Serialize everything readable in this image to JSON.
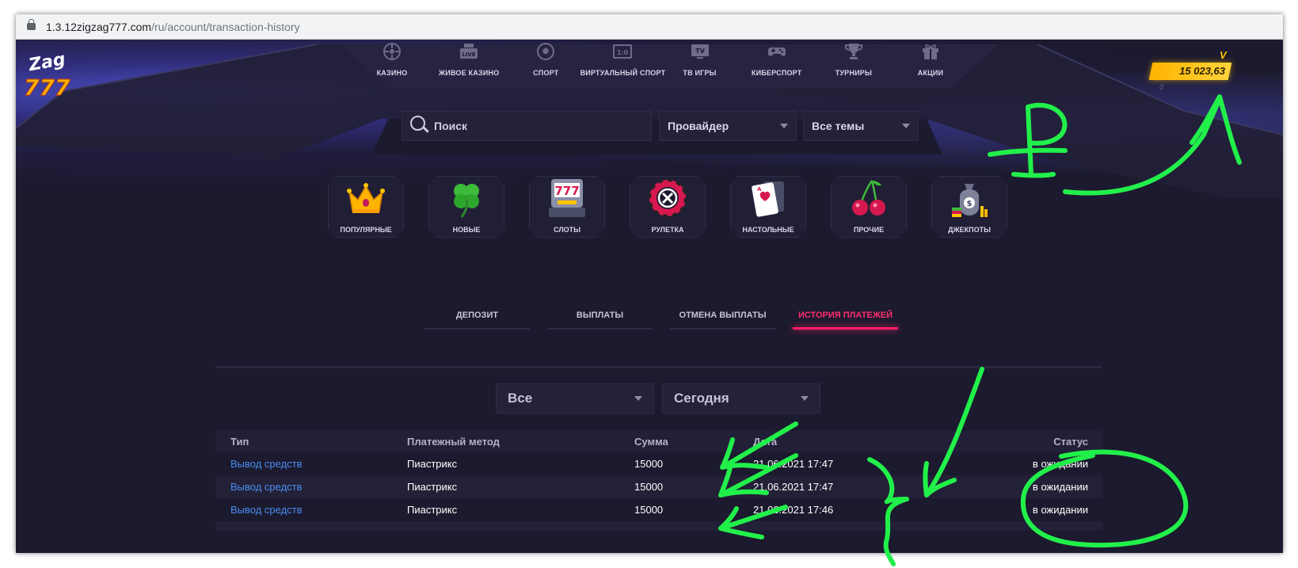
{
  "browser": {
    "url_host": "1.3.12zigzag777.com",
    "url_path": "/ru/account/transaction-history"
  },
  "logo": {
    "text_top": "Zag",
    "text_bottom": "777"
  },
  "topnav": [
    {
      "label": "КАЗИНО",
      "icon": "roulette-wheel-icon"
    },
    {
      "label": "ЖИВОЕ КАЗИНО",
      "icon": "live-camera-icon"
    },
    {
      "label": "СПОРТ",
      "icon": "soccer-ball-icon"
    },
    {
      "label": "ВИРТУАЛЬНЫЙ СПОРТ",
      "icon": "scoreboard-icon"
    },
    {
      "label": "ТВ ИГРЫ",
      "icon": "tv-icon"
    },
    {
      "label": "КИБЕРСПОРТ",
      "icon": "gamepad-icon"
    },
    {
      "label": "ТУРНИРЫ",
      "icon": "trophy-icon"
    },
    {
      "label": "АКЦИИ",
      "icon": "gift-icon"
    }
  ],
  "balance": {
    "value": "15 023,63",
    "label_v": "V",
    "secondary": "0"
  },
  "search": {
    "placeholder": "Поиск"
  },
  "filters_top": {
    "provider": "Провайдер",
    "themes": "Все темы"
  },
  "categories": [
    {
      "label": "ПОПУЛЯРНЫЕ",
      "icon": "crown-icon"
    },
    {
      "label": "НОВЫЕ",
      "icon": "clover-icon"
    },
    {
      "label": "СЛОТЫ",
      "icon": "slot-machine-icon"
    },
    {
      "label": "РУЛЕТКА",
      "icon": "roulette-icon"
    },
    {
      "label": "НАСТОЛЬНЫЕ",
      "icon": "playing-card-icon"
    },
    {
      "label": "ПРОЧИЕ",
      "icon": "cherries-icon"
    },
    {
      "label": "ДЖЕКПОТЫ",
      "icon": "money-bag-icon"
    }
  ],
  "tabs": [
    {
      "label": "ДЕПОЗИТ",
      "active": false
    },
    {
      "label": "ВЫПЛАТЫ",
      "active": false
    },
    {
      "label": "ОТМЕНА ВЫПЛАТЫ",
      "active": false
    },
    {
      "label": "ИСТОРИЯ ПЛАТЕЖЕЙ",
      "active": true
    }
  ],
  "history_filters": {
    "type": "Все",
    "period": "Сегодня"
  },
  "table": {
    "headers": [
      "Тип",
      "Платежный метод",
      "Сумма",
      "Дата",
      "Статус"
    ],
    "rows": [
      [
        "Вывод средств",
        "Пиастрикс",
        "15000",
        "21.06.2021 17:47",
        "в ожидании"
      ],
      [
        "Вывод средств",
        "Пиастрикс",
        "15000",
        "21.06.2021 17:47",
        "в ожидании"
      ],
      [
        "Вывод средств",
        "Пиастрикс",
        "15000",
        "21.06.2021 17:46",
        "в ожидании"
      ]
    ]
  },
  "colors": {
    "accent": "#ff1f66",
    "link": "#4a8df0",
    "balance": "#ffc400",
    "annotation": "#22f04a",
    "background": "#1c1a2e"
  }
}
